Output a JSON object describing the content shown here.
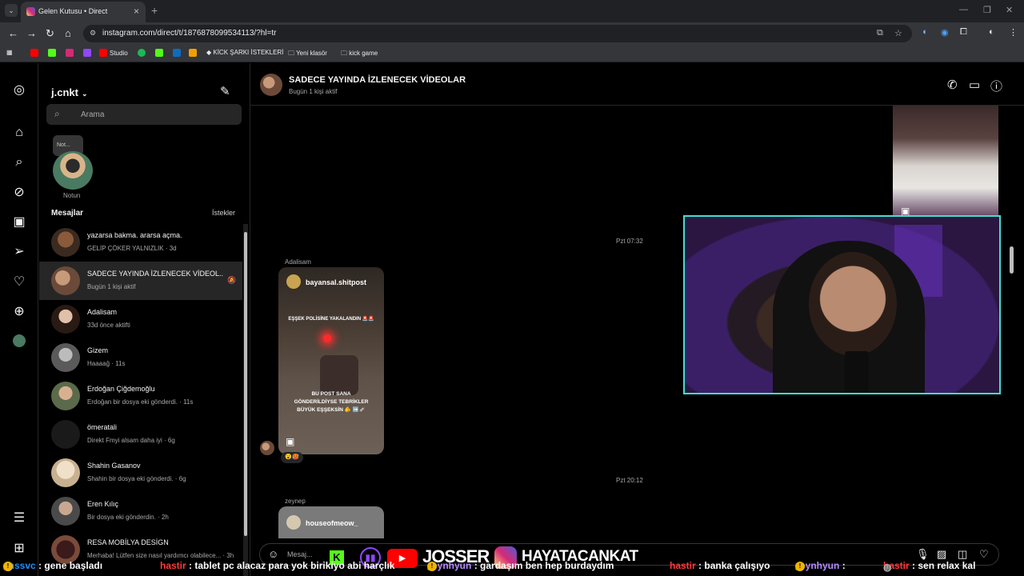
{
  "browser": {
    "tab_title": "Gelen Kutusu • Direct",
    "url": "instagram.com/direct/t/1876878099534113/?hl=tr",
    "bookmarks": [
      "Studio",
      "KİCK ŞARKI İSTEKLERİ",
      "Yeni klasör",
      "kick game"
    ]
  },
  "inbox": {
    "username": "j.cnkt",
    "search_placeholder": "Arama",
    "note_bubble": "Not...",
    "note_label": "Notun",
    "section_title": "Mesajlar",
    "requests_label": "İstekler",
    "threads": [
      {
        "name": "yazarsa bakma. ararsa açma.",
        "sub": "GELİP ÇÖKER YALNIZLIK · 3d"
      },
      {
        "name": "SADECE YAYINDA İZLENECEK VİDEOL...",
        "sub": "Bugün 1 kişi aktif"
      },
      {
        "name": "Adalisam",
        "sub": "33d önce aktifti"
      },
      {
        "name": "Gizem",
        "sub": "Haaaağ · 11s"
      },
      {
        "name": "Erdoğan Çiğdemoğlu",
        "sub": "Erdoğan bir dosya eki gönderdi. · 11s"
      },
      {
        "name": "ömeratali",
        "sub": "Direkt Fmyi alsam daha iyi · 6g"
      },
      {
        "name": "Shahin Gasanov",
        "sub": "Shahin bir dosya eki gönderdi. · 6g"
      },
      {
        "name": "Eren Kılıç",
        "sub": "Bir dosya eki gönderdin. · 2h"
      },
      {
        "name": "RESA MOBİLYA DESİGN",
        "sub": "Merhaba! Lütfen size nasıl yardımcı olabilece... · 3h"
      }
    ]
  },
  "conversation": {
    "title": "SADECE YAYINDA İZLENECEK VİDEOLAR",
    "subtitle": "Bugün 1 kişi aktif",
    "timestamp1": "Pzt 07:32",
    "timestamp2": "Pzt 20:12",
    "sender1": "Adalisam",
    "sender2": "zeynep",
    "post1": {
      "user": "bayansal.shitpost",
      "caption_top": "EŞŞEK POLİSİNE YAKALANDIN 🚨🚨",
      "caption_bottom": "BU POST SANA GÖNDERİLDİYSE TEBRİKLER BÜYÜK EŞŞEKSİN 🫵 ➡️🫏",
      "reactions": "😮🥵"
    },
    "post2": {
      "user": "houseofmeow_"
    },
    "message_placeholder": "Mesaj..."
  },
  "overlay": {
    "logo_k": "K",
    "logo_name1": "JOSSER",
    "logo_name2": "HAYATACANKAT",
    "chat": [
      {
        "user": "enssvc",
        "text": ": gene başladı",
        "color": "#1e90ff"
      },
      {
        "user": "hastir",
        "text": ": tablet pc alacaz para yok birikiyo abi harçlık",
        "color": "#ff3b3b"
      },
      {
        "user": "zeynhyun",
        "text": ": gardaşım ben hep burdaydım",
        "color": "#b58cff"
      },
      {
        "user": "hastir",
        "text": ": banka çalışıyo",
        "color": "#ff3b3b"
      },
      {
        "user": "zeynhyun",
        "text": ":",
        "color": "#b58cff"
      },
      {
        "user": "hastir",
        "text": ": sen relax kal",
        "color": "#ff3b3b"
      }
    ]
  },
  "colors": {
    "webcam_border": "#3fe0d0",
    "active_thread": "#262626"
  }
}
